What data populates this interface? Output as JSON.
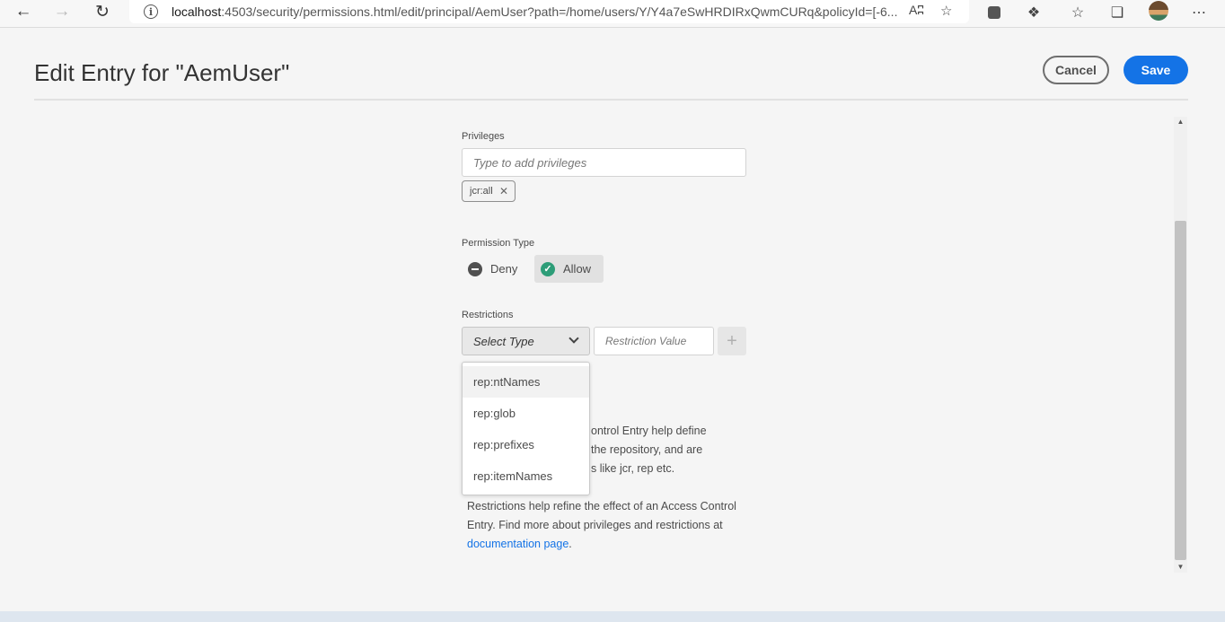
{
  "browser": {
    "url_host": "localhost",
    "url_rest": ":4503/security/permissions.html/edit/principal/AemUser?path=/home/users/Y/Y4a7eSwHRDIRxQwmCURq&policyId=[-6...",
    "read_aloud_label": "Aʭ"
  },
  "header": {
    "title": "Edit Entry for \"AemUser\"",
    "cancel_label": "Cancel",
    "save_label": "Save"
  },
  "privileges": {
    "label": "Privileges",
    "placeholder": "Type to add privileges",
    "tags": [
      "jcr:all"
    ]
  },
  "permission_type": {
    "label": "Permission Type",
    "options": [
      {
        "label": "Deny",
        "selected": false
      },
      {
        "label": "Allow",
        "selected": true
      }
    ]
  },
  "restrictions": {
    "label": "Restrictions",
    "type_placeholder": "Select Type",
    "value_placeholder": "Restriction Value",
    "add_label": "+",
    "options": [
      "rep:ntNames",
      "rep:glob",
      "rep:prefixes",
      "rep:itemNames"
    ]
  },
  "help": {
    "privileges_lines": [
      "ontrol Entry help define",
      "the repository, and are",
      "s like jcr, rep etc."
    ],
    "restrictions_text": "Restrictions help refine the effect of an Access Control Entry. Find more about privileges and restrictions at",
    "link_label": "documentation page",
    "link_suffix": "."
  }
}
